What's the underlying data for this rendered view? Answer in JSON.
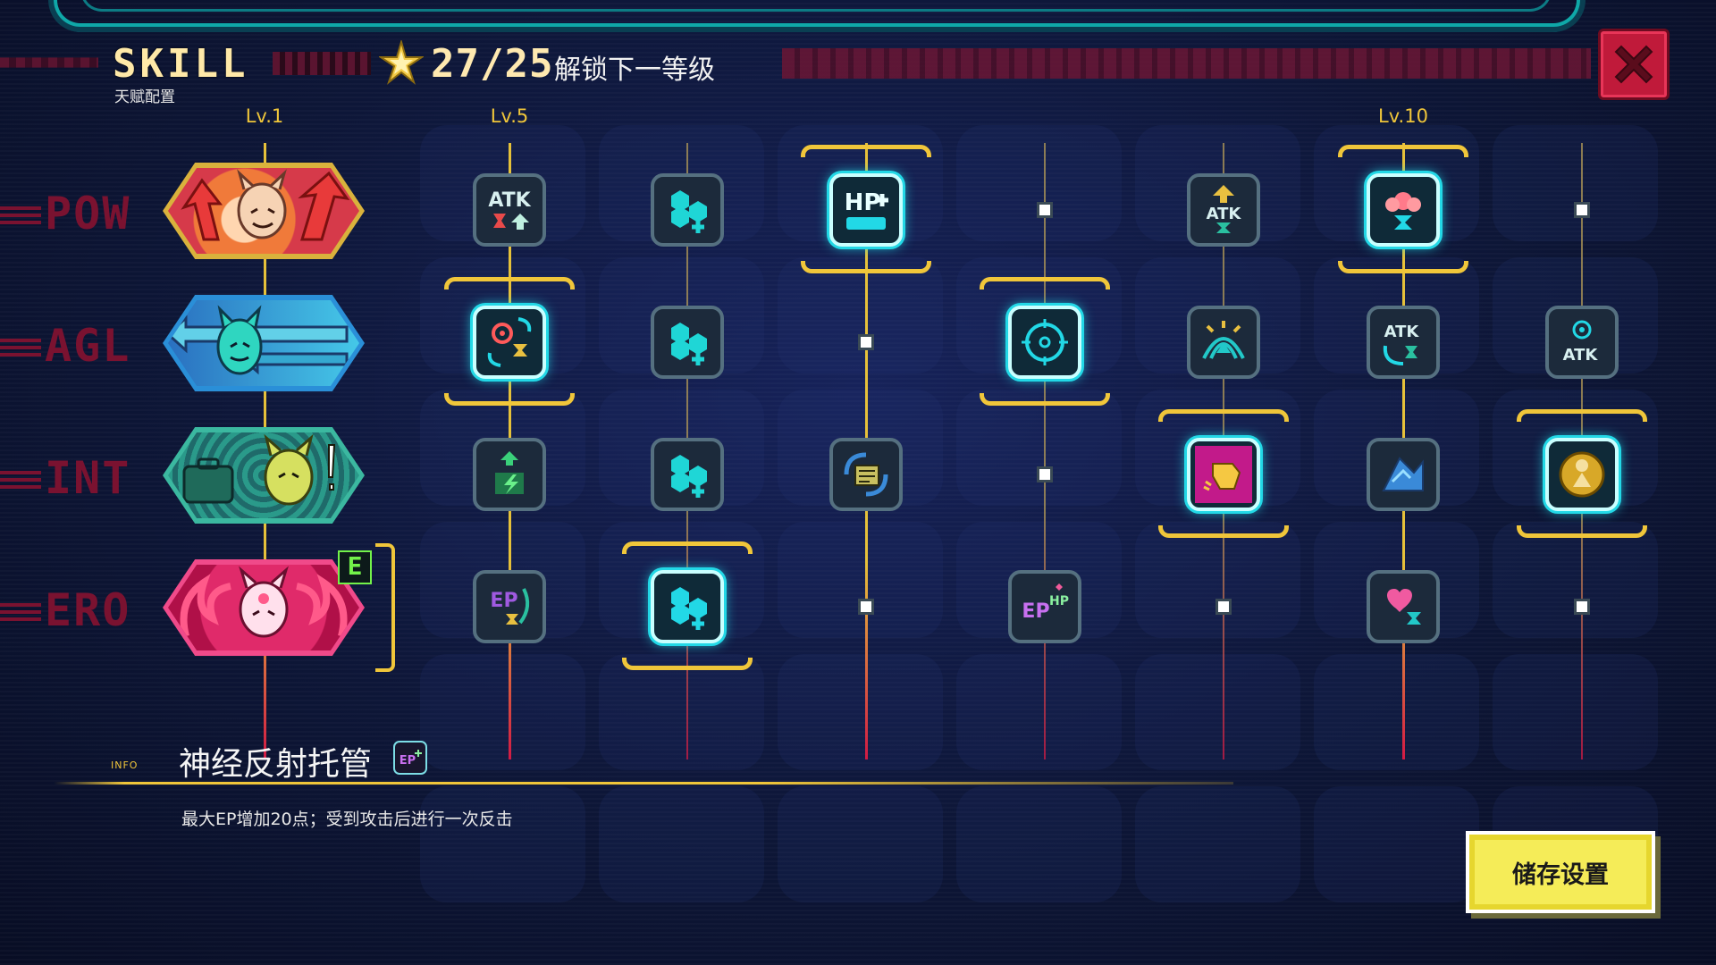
{
  "header": {
    "title": "SKILL",
    "subtitle": "天赋配置",
    "points": "27/25",
    "unlock_text": "解锁下一等级"
  },
  "levels": [
    "Lv.1",
    "Lv.5",
    "Lv.10"
  ],
  "rows": [
    "POW",
    "AGL",
    "INT",
    "ERO"
  ],
  "character_badge": "E",
  "info": {
    "tag": "INFO",
    "title": "神经反射托管",
    "description": "最大EP增加20点；受到攻击后进行一次反击"
  },
  "save_button": "储存设置",
  "colors": {
    "gold": "#f0c63a",
    "cyan": "#22d8e6",
    "close_red": "#c01a3a",
    "save_yellow": "#f5ec58"
  },
  "nodes": {
    "pow": [
      "atk-timer-icon",
      "hex-plus-icon",
      "hp-plus-icon",
      "locked",
      "atk-up-icon",
      "flower-timer-icon",
      "locked"
    ],
    "agl": [
      "target-timer-icon",
      "hex-plus-icon",
      "locked",
      "crosshair-icon",
      "dome-icon",
      "atk-cycle-icon",
      "atk-target-icon"
    ],
    "int": [
      "lightning-up-icon",
      "hex-plus-icon",
      "cycle-doc-icon",
      "locked",
      "gold-fist-icon",
      "blue-shield-icon",
      "gold-statue-icon"
    ],
    "ero": [
      "ep-timer-icon",
      "hex-plus-icon",
      "locked",
      "ep-hp-icon",
      "locked",
      "heart-timer-icon",
      "locked"
    ]
  }
}
